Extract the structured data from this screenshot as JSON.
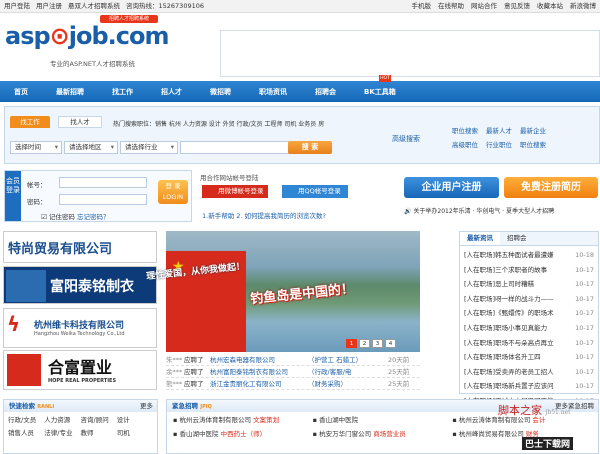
{
  "topbar": {
    "left": [
      "用户登陆",
      "用户注册",
      "悬双人才招聘系统",
      "咨询热线：15267309106"
    ],
    "right": [
      "手机版",
      "在线帮助",
      "网站合作",
      "意见反馈",
      "收藏本站",
      "新浪微博"
    ]
  },
  "logo": {
    "main": "asp",
    "dot": "🔍",
    "tail": "job.com",
    "tagline": "专业的ASP.NET人才招聘系统",
    "badge": "招聘人才招聘系统"
  },
  "nav": [
    "首页",
    "最新招聘",
    "找工作",
    "招人才",
    "微招聘",
    "职场资讯",
    "招聘会",
    "BK工具箱"
  ],
  "nav_hot": "HOT",
  "search": {
    "tab_job": "找工作",
    "tab_talent": "找人才",
    "hot_positions": "热门搜索职位：销售  杭州  人力资源  设计  外贸  行政/文员  工程师  司机  业务员  房",
    "sel_time": "选择时间",
    "sel_area": "请选择地区",
    "sel_industry": "请选择行业",
    "button": "搜 索",
    "advanced": "高级搜索"
  },
  "categories": [
    [
      "职位搜索",
      "最新人才",
      "最新企业"
    ],
    [
      "高级职位",
      "行业职位",
      "职位搜索"
    ]
  ],
  "login": {
    "side": "会员登录",
    "account": "帐号：",
    "password": "密码：",
    "remember": "记住密码",
    "forgot": "忘记密码？",
    "button": "登 录\nLOGIN"
  },
  "coop": {
    "title": "用合作网站帐号登陆",
    "weibo": "用微博帐号登录",
    "qq": "用QQ帐号登录",
    "tips": "1.新手帮助  2. 如何提高我简历的浏览次数?"
  },
  "register": {
    "company": "企业用户注册",
    "resume": "免费注册简历"
  },
  "fair_notice": "关于举办2012年乐清 · 华创电气 · 夏季大型人才招聘",
  "ads": [
    "特尚贸易有限公司",
    "富阳泰铭制衣",
    "杭州维卡科技有限公司",
    "合富置业"
  ],
  "ad_sub": [
    "",
    "",
    "Hangzhou Weika Technology Co.,Ltd",
    "HOPE REAL PROPERTIES"
  ],
  "slider": {
    "slogan1": "理性爱国，从你我做起！",
    "slogan2": "钓鱼岛是中国的！",
    "pages": [
      "1",
      "2",
      "3",
      "4"
    ]
  },
  "applies": [
    {
      "who": "朱***",
      "action": "应聘了",
      "company": "杭州宏森电器有限公司",
      "job": "（护营工 石蜡工）",
      "time": "20天前"
    },
    {
      "who": "余***",
      "action": "应聘了",
      "company": "杭州富阳泰铭制衣有限公司",
      "job": "（行政/客服/电",
      "time": "25天前"
    },
    {
      "who": "熊***",
      "action": "应聘了",
      "company": "浙江金贵丽化工有限公司",
      "job": "（财务采购）",
      "time": "25天前"
    }
  ],
  "news": {
    "tabs": [
      "最新资讯",
      "招聘会"
    ],
    "items": [
      {
        "t": "[人在职场]韩五种面试者最遭嫌",
        "d": "10-18"
      },
      {
        "t": "[人在职场]三个求职者的故事",
        "d": "10-17"
      },
      {
        "t": "[人在职场]恶上司时糟糕",
        "d": "10-17"
      },
      {
        "t": "[人在职场]呀一样的战斗力——",
        "d": "10-17"
      },
      {
        "t": "[人在职场]《甄嬛传》的职场术",
        "d": "10-17"
      },
      {
        "t": "[人在职场]职场小事见真能力",
        "d": "10-17"
      },
      {
        "t": "[人在职场]职场不与朵高点再立",
        "d": "10-17"
      },
      {
        "t": "[人在职场]职场体名升工四",
        "d": "10-17"
      },
      {
        "t": "[人在职场]受卖弄的老员工招人",
        "d": "10-17"
      },
      {
        "t": "[人在职场]职场新兵置子应该问",
        "d": "10-17"
      },
      {
        "t": "[人在职场]面试中小尾巴可不能",
        "d": "10-17"
      }
    ]
  },
  "quick": {
    "title": "快速检索",
    "sub": "RANLI",
    "more": "更多",
    "items": [
      "行政/文员",
      "人力资源",
      "咨询/顾问",
      "设计",
      "销售人员",
      "法律/专业",
      "教师",
      "司机"
    ]
  },
  "urgent": {
    "title": "紧急招聘",
    "sub": "JPIQ",
    "more": "更多紧急招聘",
    "rows": [
      [
        {
          "c": "杭州云涛体育制有限公司",
          "j": "文案策划"
        },
        {
          "c": "香山湖中医院",
          "j": ""
        },
        {
          "c": "杭州云涛体育制有限公司",
          "j": "会计"
        }
      ],
      [
        {
          "c": "香山湖中医院",
          "j": "中西药士（师）"
        },
        {
          "c": "杭安万华门窗公司",
          "j": "商场营业员"
        },
        {
          "c": "杭州峰尚贸易有限公司",
          "j": "财务"
        }
      ]
    ]
  },
  "watermark": {
    "a": "脚本之家",
    "b": "jb51.net",
    "c": "巴士下载网"
  }
}
